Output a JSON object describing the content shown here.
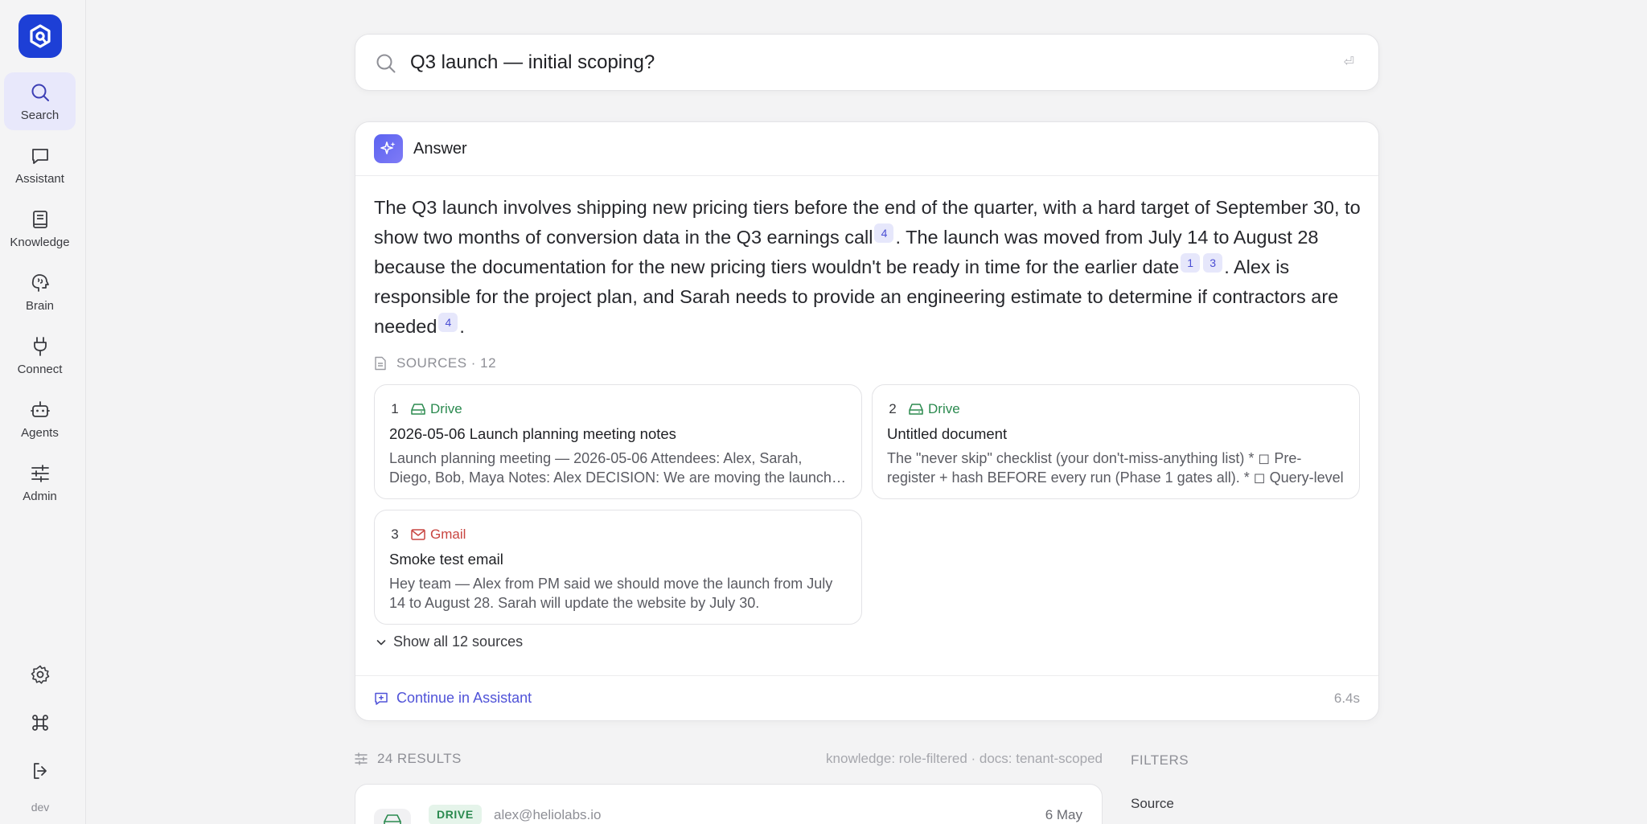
{
  "sidebar": {
    "items": [
      {
        "label": "Search"
      },
      {
        "label": "Assistant"
      },
      {
        "label": "Knowledge"
      },
      {
        "label": "Brain"
      },
      {
        "label": "Connect"
      },
      {
        "label": "Agents"
      },
      {
        "label": "Admin"
      }
    ],
    "active": "Search",
    "env_label": "dev"
  },
  "search": {
    "query": "Q3 launch — initial scoping?",
    "enter_hint": "⏎"
  },
  "answer": {
    "title": "Answer",
    "segments": [
      "The Q3 launch involves shipping new pricing tiers before the end of the quarter, with a hard target of September 30, to show two months of conversion data in the Q3 earnings call",
      ". The launch was moved from July 14 to August 28 because the documentation for the new pricing tiers wouldn't be ready in time for the earlier date",
      ". Alex is responsible for the project plan, and Sarah needs to provide an engineering estimate to determine if contractors are needed",
      "."
    ],
    "citations": [
      "4",
      "1",
      "3",
      "4"
    ],
    "sources_label": "SOURCES · 12",
    "sources": [
      {
        "num": "1",
        "provider": "Drive",
        "title": "2026-05-06 Launch planning meeting notes",
        "snippet": "Launch planning meeting — 2026-05-06 Attendees: Alex, Sarah, Diego, Bob, Maya Notes: Alex DECISION: We are moving the launch date"
      },
      {
        "num": "2",
        "provider": "Drive",
        "title": "Untitled document",
        "snippet": "The \"never skip\" checklist (your don't-miss-anything list) * ◻ Pre-register + hash BEFORE every run (Phase 1 gates all). * ◻ Query-level"
      },
      {
        "num": "3",
        "provider": "Gmail",
        "title": "Smoke test email",
        "snippet": "Hey team — Alex from PM said we should move the launch from July 14 to August 28. Sarah will update the website by July 30."
      }
    ],
    "show_all_label": "Show all 12 sources",
    "continue_label": "Continue in Assistant",
    "elapsed": "6.4s"
  },
  "results": {
    "count_label": "24 RESULTS",
    "meta": "knowledge: role-filtered · docs: tenant-scoped",
    "rows": [
      {
        "badge": "DRIVE",
        "author": "alex@heliolabs.io",
        "date": "6 May"
      }
    ]
  },
  "filters": {
    "title": "FILTERS",
    "source_label": "Source"
  },
  "colors": {
    "brand": "#1d3fd6",
    "accent": "#5053d8",
    "drive": "#2b8a4f",
    "gmail": "#c84540",
    "citation_bg": "#e6e7fb"
  }
}
